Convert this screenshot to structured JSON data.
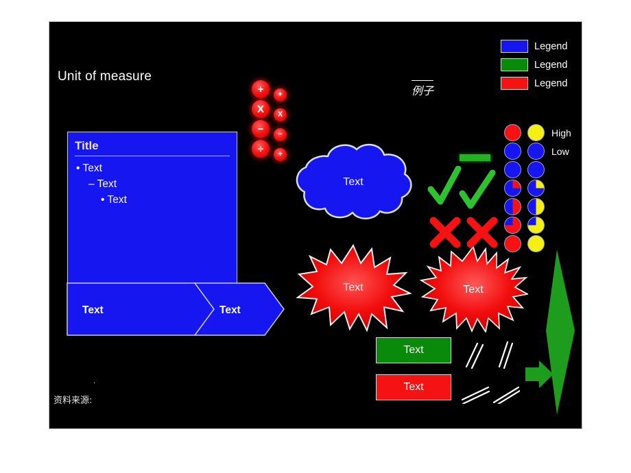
{
  "slide": {
    "background_color": "#000000",
    "unit_of_measure": "Unit of measure",
    "example_mark": "例子",
    "source_dot": "·",
    "source_label": "资料来源:"
  },
  "legend": {
    "items": [
      {
        "label": "Legend",
        "color": "#1616f0"
      },
      {
        "label": "Legend",
        "color": "#0a8a0a"
      },
      {
        "label": "Legend",
        "color": "#f51212"
      }
    ]
  },
  "operators": {
    "large": [
      {
        "name": "plus-operator",
        "glyph": "+"
      },
      {
        "name": "multiply-operator",
        "glyph": "X"
      },
      {
        "name": "minus-operator",
        "glyph": "−"
      },
      {
        "name": "divide-operator",
        "glyph": "÷"
      }
    ],
    "small": [
      {
        "name": "plus-operator",
        "glyph": "+"
      },
      {
        "name": "multiply-operator",
        "glyph": "X"
      },
      {
        "name": "minus-operator",
        "glyph": "−"
      },
      {
        "name": "divide-operator",
        "glyph": "÷"
      }
    ],
    "color": "#f51414"
  },
  "title_box": {
    "title": "Title",
    "title_color": "#f2e7b8",
    "fill_color": "#1616f0",
    "bullets": [
      {
        "marker": "•",
        "text": "Text"
      },
      {
        "marker": "–",
        "text": "Text"
      },
      {
        "marker": "•",
        "text": "Text"
      }
    ]
  },
  "chevron_bar": {
    "fill_color": "#1616f0",
    "segments": [
      {
        "label": "Text"
      },
      {
        "label": "Text"
      }
    ]
  },
  "cloud": {
    "label": "Text",
    "fill_color": "#1616f0"
  },
  "stars": [
    {
      "label": "Text",
      "fill_color": "#f51212",
      "points": 16
    },
    {
      "label": "Text",
      "fill_color": "#f51212",
      "points": 24
    }
  ],
  "marks": {
    "dash_color": "#22b222",
    "check_color": "#2fc22f",
    "cross_color": "#f51212",
    "check_count": 2,
    "cross_count": 2
  },
  "status_boxes": [
    {
      "label": "Text",
      "fill_color": "#0a8a0a"
    },
    {
      "label": "Text",
      "fill_color": "#f51212"
    }
  ],
  "break_marks": {
    "count": 4,
    "color": "#ffffff"
  },
  "green_arrows": {
    "small_arrow_color": "#1d9c1d",
    "leaf_color": "#1d9c1d"
  },
  "harvey_balls": {
    "header_labels": [
      "High",
      "Low"
    ],
    "left_color": "#f51212",
    "right_color": "#f5ef12",
    "base_color": "#1616f0",
    "ring_color": "#9b9bdd",
    "rows": [
      {
        "fill_pct": 100,
        "type": "solid",
        "label": "High"
      },
      {
        "fill_pct": 0,
        "type": "empty",
        "label": "Low"
      },
      {
        "fill_pct": 0,
        "type": "empty",
        "label": ""
      },
      {
        "fill_pct": 25,
        "type": "pie",
        "label": ""
      },
      {
        "fill_pct": 50,
        "type": "pie",
        "label": ""
      },
      {
        "fill_pct": 75,
        "type": "pie",
        "label": ""
      },
      {
        "fill_pct": 100,
        "type": "solid",
        "label": ""
      }
    ]
  }
}
